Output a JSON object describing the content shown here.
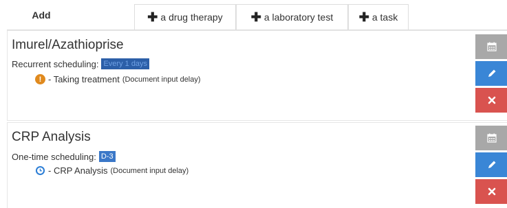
{
  "tabs": {
    "add_label": "Add",
    "items": [
      {
        "label": "a drug therapy"
      },
      {
        "label": "a laboratory test"
      },
      {
        "label": "a task"
      }
    ]
  },
  "cards": [
    {
      "title": "Imurel/Azathioprise",
      "schedule_label": "Recurrent scheduling:",
      "schedule_value": "Every 1 days",
      "item_icon": "warning-icon",
      "item_text": "- Taking treatment",
      "item_note": "(Document input delay)"
    },
    {
      "title": "CRP Analysis",
      "schedule_label": "One-time scheduling:",
      "schedule_value": "D-3",
      "item_icon": "clock-icon",
      "item_text": "- CRP Analysis",
      "item_note": "(Document input delay)"
    }
  ],
  "colors": {
    "calendar_button": "#a8a8a8",
    "edit_button": "#3a86d6",
    "delete_button": "#d9534f",
    "badge": "#3b78c8",
    "warning": "#e08a1e",
    "clock": "#2e7fd6"
  }
}
